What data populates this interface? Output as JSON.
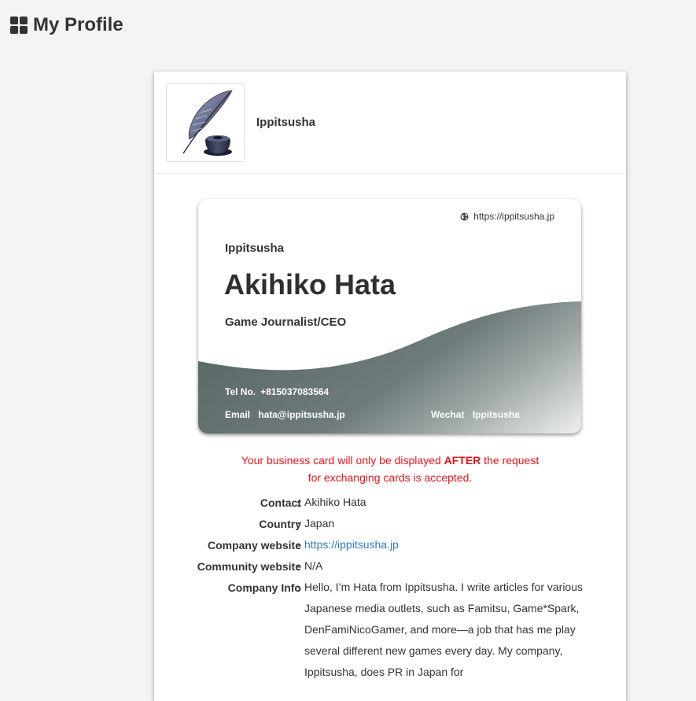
{
  "header": {
    "title": "My Profile"
  },
  "profile": {
    "company": "Ippitsusha"
  },
  "card": {
    "url": "https://ippitsusha.jp",
    "company": "Ippitsusha",
    "name": "Akihiko Hata",
    "role": "Game Journalist/CEO",
    "tel_label": "Tel No.",
    "tel": "+815037083564",
    "email_label": "Email",
    "email": "hata@ippitsusha.jp",
    "wechat_label": "Wechat",
    "wechat": "Ippitsusha",
    "colors": {
      "wave_light": "#c9cfcf",
      "wave_dark": "#5c6a6a"
    }
  },
  "notice": {
    "part1": "Your business card will only be displayed ",
    "emphasis": "AFTER",
    "part2": " the request",
    "line2": "for exchanging cards is accepted.",
    "color": "#e8141b"
  },
  "details": {
    "colon": ":",
    "contact_label": "Contact",
    "contact": "Akihiko Hata",
    "country_label": "Country",
    "country": "Japan",
    "website_label": "Company website",
    "website": "https://ippitsusha.jp",
    "community_label": "Community website",
    "community": "N/A",
    "info_label": "Company Info",
    "info": "Hello, I’m Hata from Ippitsusha. I write articles for various Japanese media outlets, such as Famitsu, Game*Spark, DenFamiNicoGamer, and more—a job that has me play several different new games every day. My company, Ippitsusha, does PR in Japan for"
  }
}
